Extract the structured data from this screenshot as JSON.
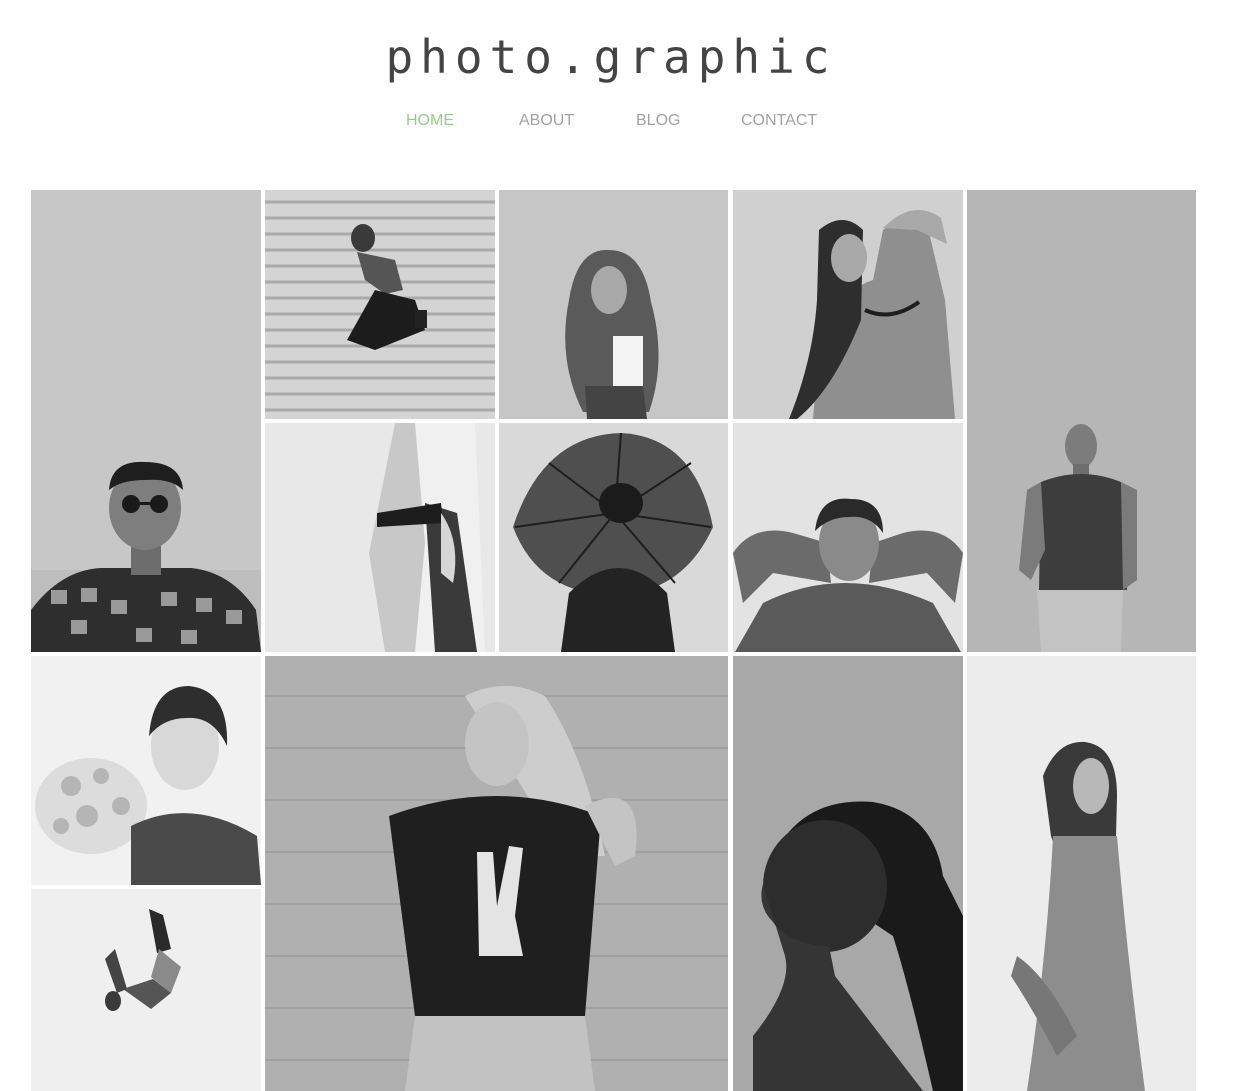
{
  "site": {
    "logo": "photo.graphic"
  },
  "nav": {
    "items": [
      {
        "label": "HOME",
        "active": true
      },
      {
        "label": "ABOUT",
        "active": false
      },
      {
        "label": "BLOG",
        "active": false
      },
      {
        "label": "CONTACT",
        "active": false
      }
    ],
    "active_color": "#92cf86",
    "inactive_color": "#a2a2a2"
  },
  "gallery": {
    "photos": [
      {
        "name": "photo-man-sunglasses-icon",
        "subject": "man in sunglasses and checkered shirt"
      },
      {
        "name": "photo-woman-jumping-shutter-icon",
        "subject": "woman jumping in front of shutter"
      },
      {
        "name": "photo-woman-curly-hair-icon",
        "subject": "woman with curly hair"
      },
      {
        "name": "photo-woman-arm-raised-icon",
        "subject": "woman with arm raised"
      },
      {
        "name": "photo-man-polo-wall-icon",
        "subject": "man in polo leaning on wall"
      },
      {
        "name": "photo-woman-light-coat-icon",
        "subject": "woman in light coat"
      },
      {
        "name": "photo-woman-umbrella-icon",
        "subject": "woman with umbrella"
      },
      {
        "name": "photo-man-hands-behind-head-icon",
        "subject": "man with hands behind head"
      },
      {
        "name": "photo-woman-flowers-icon",
        "subject": "woman with flowers"
      },
      {
        "name": "photo-woman-peace-shirt-icon",
        "subject": "woman in peace sign shirt"
      },
      {
        "name": "photo-woman-ponytail-profile-icon",
        "subject": "woman with ponytail in profile"
      },
      {
        "name": "photo-woman-long-dress-icon",
        "subject": "woman in long dress"
      },
      {
        "name": "photo-jumping-figure-icon",
        "subject": "figure jumping"
      }
    ]
  }
}
